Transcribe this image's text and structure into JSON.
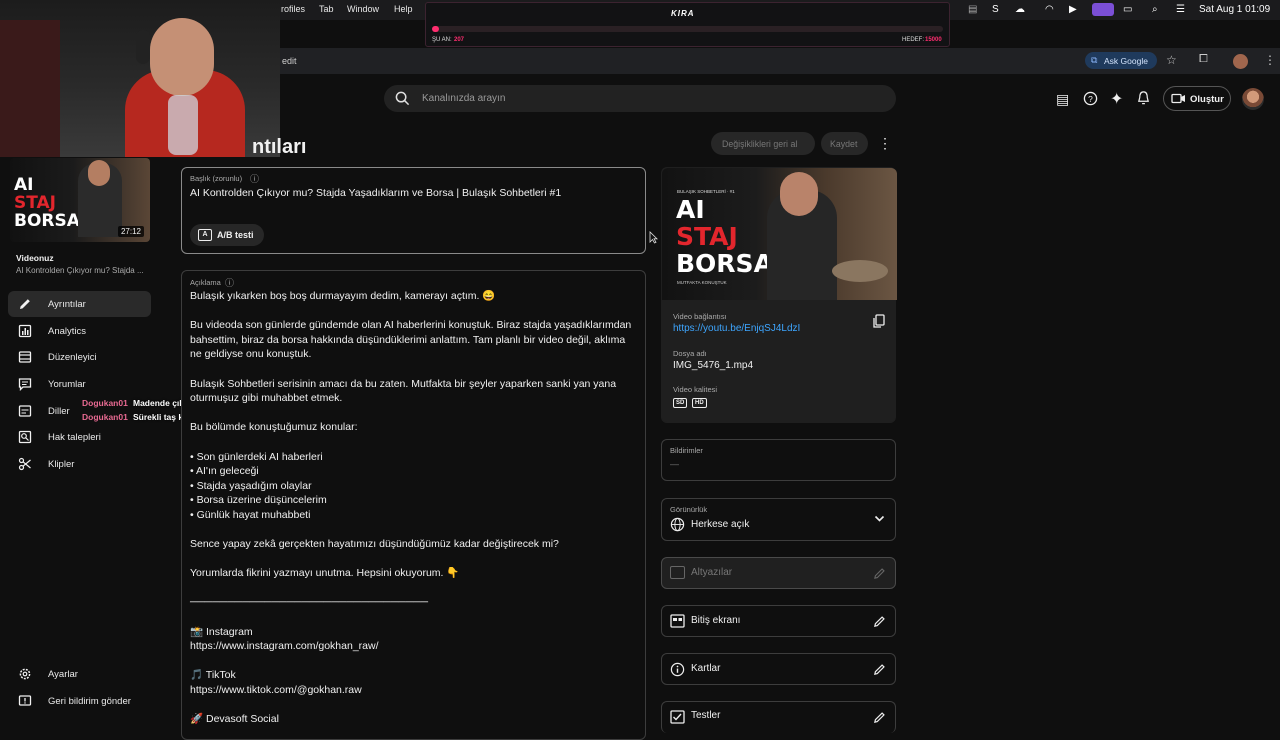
{
  "menubar": {
    "items": [
      "rofiles",
      "Tab",
      "Window",
      "Help"
    ],
    "clock": "Sat Aug 1  01:09"
  },
  "overlay": {
    "brand": "KIRA",
    "current_label": "ŞU AN:",
    "current_value": "207",
    "target_label": "HEDEF:",
    "target_value": "15000",
    "progress": 0.014
  },
  "browser": {
    "tab_fragment": "edit",
    "ask_google": "Ask Google"
  },
  "header": {
    "search_placeholder": "Kanalınızda arayın",
    "create_label": "Oluştur"
  },
  "page": {
    "title": "ntıları",
    "undo_label": "Değişiklikleri geri al",
    "save_label": "Kaydet"
  },
  "sidebar": {
    "duration": "27:12",
    "thumb_lines": [
      "AI",
      "STAJ",
      "BORSA"
    ],
    "video_heading": "Videonuz",
    "video_title": "AI Kontrolden Çıkıyor mu? Stajda ...",
    "items": [
      {
        "label": "Ayrıntılar",
        "icon": "pencil-icon"
      },
      {
        "label": "Analytics",
        "icon": "analytics-icon"
      },
      {
        "label": "Düzenleyici",
        "icon": "editor-icon"
      },
      {
        "label": "Yorumlar",
        "icon": "comments-icon"
      },
      {
        "label": "Diller",
        "icon": "languages-icon"
      },
      {
        "label": "Hak talepleri",
        "icon": "claims-icon"
      },
      {
        "label": "Klipler",
        "icon": "scissors-icon"
      }
    ],
    "settings_label": "Ayarlar",
    "feedback_label": "Geri bildirim gönder"
  },
  "chat": [
    {
      "user": "Dogukan01",
      "message": "Madende çıkışa patladım ya"
    },
    {
      "user": "Dogukan01",
      "message": "Sürekli taş koya koya"
    }
  ],
  "title_field": {
    "label": "Başlık (zorunlu)",
    "value": "AI Kontrolden Çıkıyor mu? Stajda Yaşadıklarım ve Borsa | Bulaşık Sohbetleri #1",
    "ab_test_label": "A/B testi"
  },
  "description": {
    "label": "Açıklama",
    "lines": [
      "Bulaşık yıkarken boş boş durmayayım dedim, kamerayı açtım. 😄",
      "",
      "Bu videoda son günlerde gündemde olan AI haberlerini konuştuk. Biraz stajda yaşadıklarımdan",
      "bahsettim, biraz da borsa hakkında düşündüklerimi anlattım. Tam planlı bir video değil, aklıma",
      "ne geldiyse onu konuştuk.",
      "",
      "Bulaşık Sohbetleri serisinin amacı da bu zaten. Mutfakta bir şeyler yaparken sanki yan yana",
      "oturmuşuz gibi muhabbet etmek.",
      "",
      "Bu bölümde konuştuğumuz konular:",
      "",
      "• Son günlerdeki AI haberleri",
      "• AI'ın geleceği",
      "• Stajda yaşadığım olaylar",
      "• Borsa üzerine düşüncelerim",
      "• Günlük hayat muhabbeti",
      "",
      "Sence yapay zekâ gerçekten hayatımızı düşündüğümüz kadar değiştirecek mi?",
      "",
      "Yorumlarda fikrini yazmayı unutma. Hepsini okuyorum. 👇",
      "",
      "────────────────────────────────",
      "",
      "📸 Instagram",
      "https://www.instagram.com/gokhan_raw/",
      "",
      "🎵 TikTok",
      "https://www.tiktok.com/@gokhan.raw",
      "",
      "🚀 Devasoft Social"
    ]
  },
  "video_info": {
    "thumb_tag": "BULAŞIK SOHBETLERİ · #1",
    "thumb_lines": [
      "AI",
      "STAJ",
      "BORSA"
    ],
    "thumb_sub": "MUTFAKTA KONUŞTUK",
    "link_label": "Video bağlantısı",
    "link": "https://youtu.be/EnjqSJ4LdzI",
    "file_label": "Dosya adı",
    "file": "IMG_5476_1.mp4",
    "quality_label": "Video kalitesi",
    "qualities": [
      "SD",
      "HD"
    ]
  },
  "notifications": {
    "label": "Bildirimler",
    "value": "—"
  },
  "visibility": {
    "label": "Görünürlük",
    "value": "Herkese açık"
  },
  "subtitles": {
    "label": "Altyazılar"
  },
  "end_screen": {
    "label": "Bitiş ekranı"
  },
  "cards": {
    "label": "Kartlar"
  },
  "tests": {
    "label": "Testler"
  },
  "colors": {
    "accent_link": "#3ea6ff",
    "thumb_red": "#e3262d",
    "chat_user": "#e86a92",
    "overlay_pink": "#ff2d6f"
  }
}
